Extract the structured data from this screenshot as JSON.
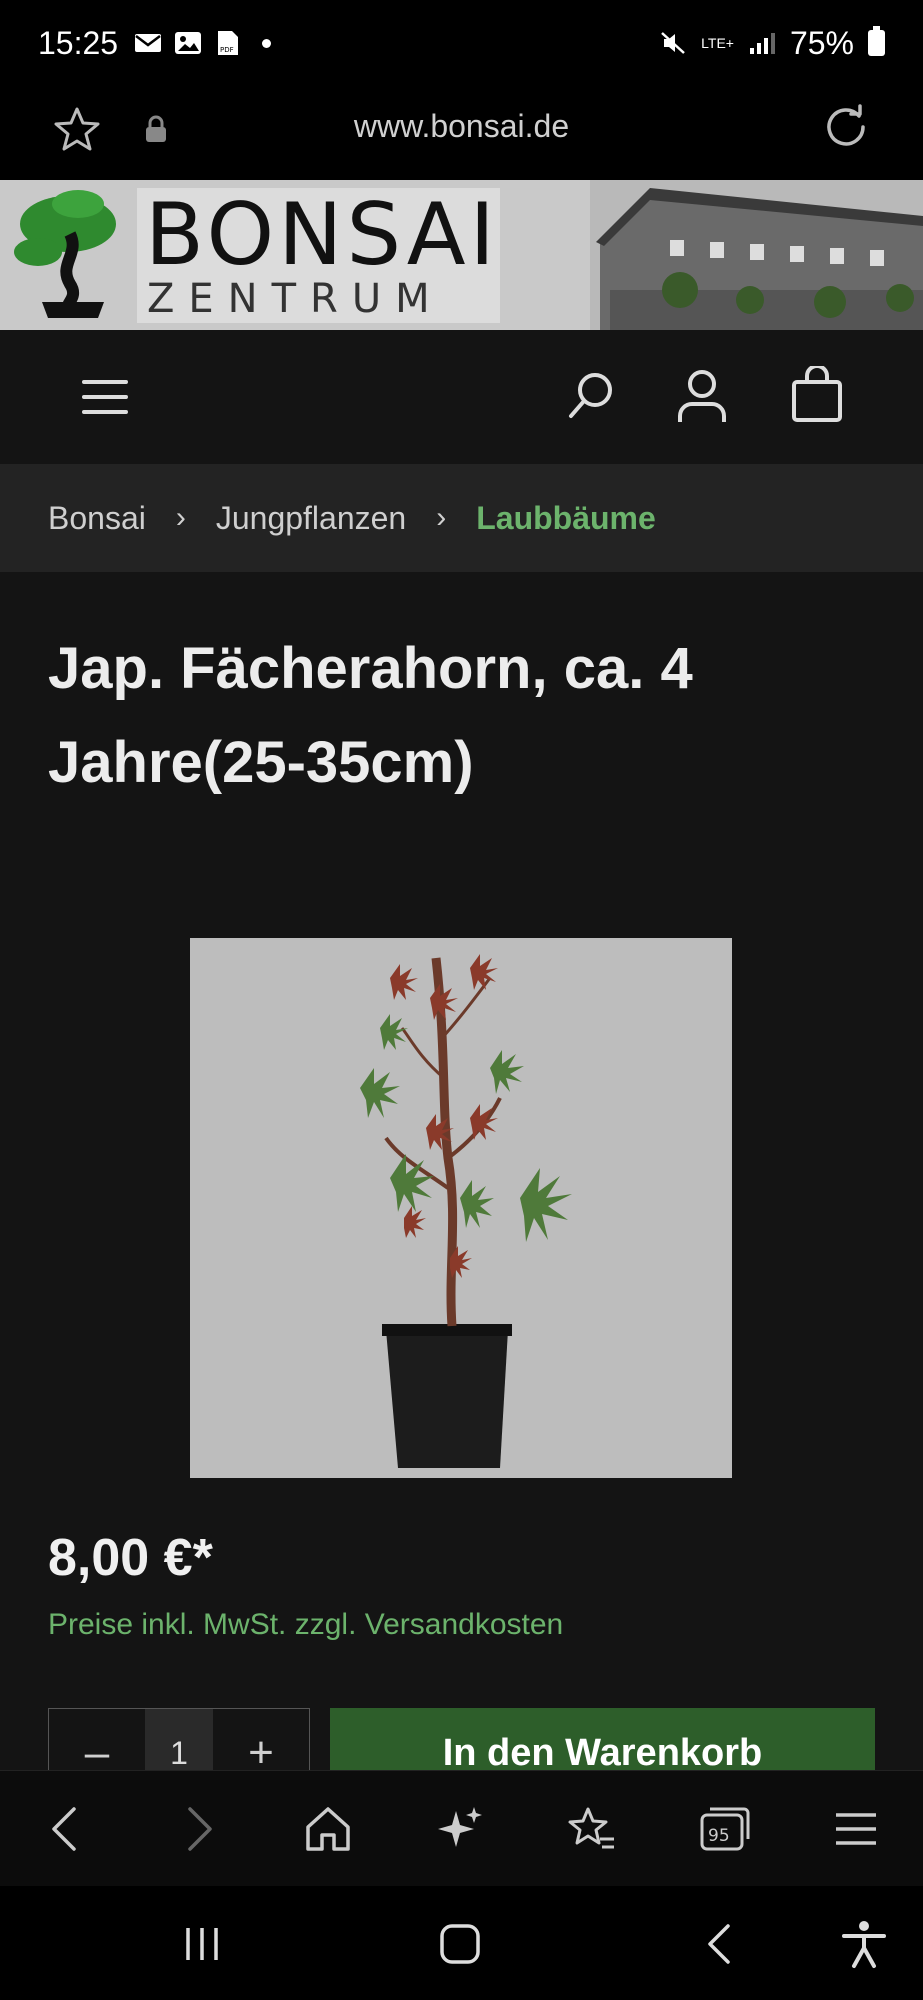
{
  "status_bar": {
    "time": "15:25",
    "network": "LTE+",
    "battery": "75%"
  },
  "browser": {
    "url": "www.bonsai.de"
  },
  "banner": {
    "logo_title": "BONSAI",
    "logo_subtitle": "ZENTRUM"
  },
  "breadcrumb": {
    "items": [
      "Bonsai",
      "Jungpflanzen",
      "Laubbäume"
    ],
    "separator": "›"
  },
  "product": {
    "title": "Jap. Fächerahorn, ca. 4 Jahre(25-35cm)",
    "price": "8,00 €*",
    "tax_note": "Preise inkl. MwSt. zzgl. Versandkosten",
    "quantity": "1",
    "decrement_label": "–",
    "increment_label": "+",
    "add_to_cart_label": "In den Warenkorb"
  },
  "toolbar": {
    "tabs_count": "95"
  },
  "colors": {
    "accent_green": "#6cb36c",
    "button_green": "#2d5e2a",
    "background": "#141414"
  }
}
